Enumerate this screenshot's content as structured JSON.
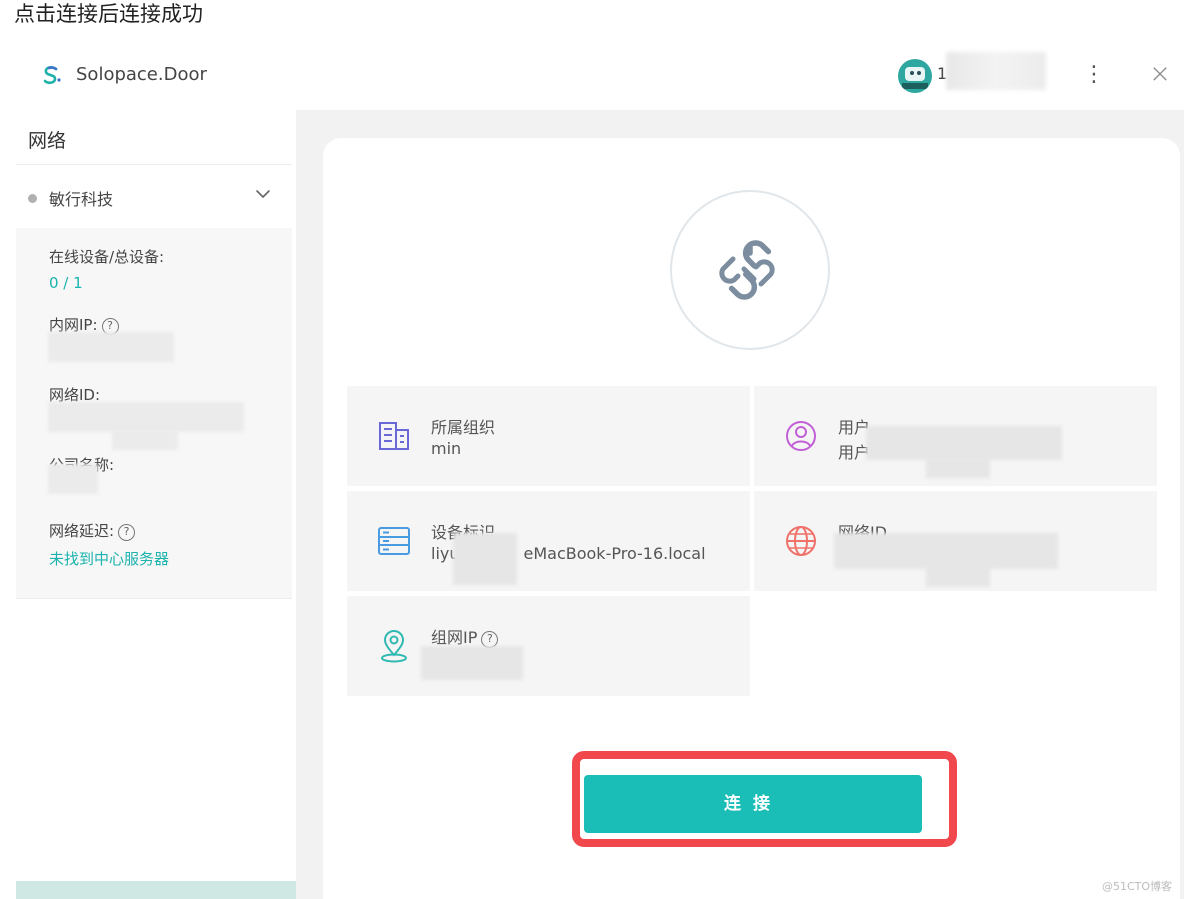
{
  "caption": "点击连接后连接成功",
  "app": {
    "title": "Solopace.Door",
    "username": "1",
    "more_icon": "more-vertical-icon",
    "close_icon": "close-icon"
  },
  "sidebar": {
    "title": "网络",
    "org": {
      "name": "敏行科技",
      "status": "offline"
    },
    "online_label": "在线设备/总设备:",
    "online_value": "0 / 1",
    "lan_ip_label": "内网IP:",
    "network_id_label": "网络ID:",
    "company_label": "公司名称:",
    "latency_label": "网络延迟:",
    "latency_value": "未找到中心服务器"
  },
  "main": {
    "tiles": [
      {
        "label": "所属组织",
        "value": "min",
        "icon": "building-icon"
      },
      {
        "label": "用户",
        "value": "用户",
        "icon": "user-icon"
      },
      {
        "label": "设备标识",
        "value_prefix": "liyu",
        "value_suffix": "eMacBook-Pro-16.local",
        "icon": "server-icon"
      },
      {
        "label": "网络ID",
        "value": "",
        "icon": "globe-icon"
      },
      {
        "label": "组网IP",
        "value": "",
        "icon": "location-icon"
      }
    ],
    "connect_label": "连接"
  },
  "colors": {
    "accent": "#1bbdb7",
    "highlight": "#f0484d"
  },
  "watermark": "@51CTO博客"
}
